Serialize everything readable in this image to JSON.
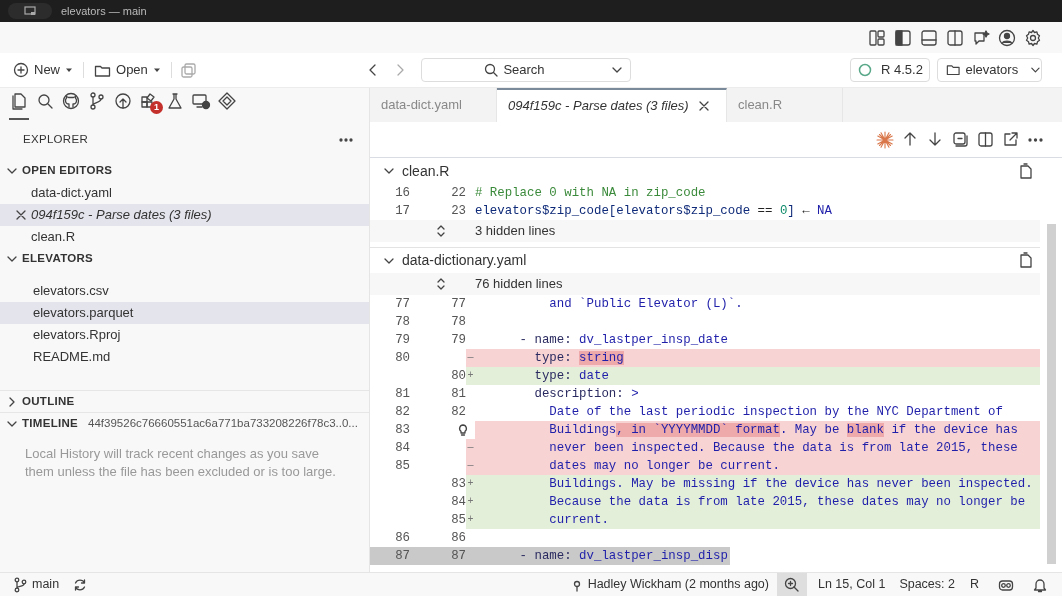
{
  "window": {
    "title": "elevators — main"
  },
  "toolbar": {
    "new_button": "New",
    "open_button": "Open",
    "search": "Search",
    "r_version": "R 4.5.2",
    "project": "elevators"
  },
  "activity_bar": [
    {
      "selected": true
    },
    {
      "selected": false
    },
    {
      "selected": false
    },
    {
      "selected": false
    },
    {
      "selected": false
    },
    {
      "selected": false,
      "badge": "1"
    },
    {
      "selected": false
    },
    {
      "selected": false
    },
    {
      "selected": false
    }
  ],
  "explorer": {
    "title": "EXPLORER",
    "sections": [
      {
        "title": "OPEN EDITORS",
        "expanded": true,
        "items": [
          {
            "label": "data-dict.yaml",
            "kind": "file",
            "selected": false
          },
          {
            "label": "094f159c - Parse dates (3 files)",
            "kind": "diff",
            "selected": true
          },
          {
            "label": "clean.R",
            "kind": "file",
            "selected": false
          }
        ]
      },
      {
        "title": "ELEVATORS",
        "expanded": true,
        "items": [
          {
            "label": "elevators.csv",
            "kind": "file",
            "selected": false
          },
          {
            "label": "elevators.parquet",
            "kind": "file",
            "selected": true
          },
          {
            "label": "elevators.Rproj",
            "kind": "file",
            "selected": false
          },
          {
            "label": "README.md",
            "kind": "file",
            "selected": false
          }
        ]
      },
      {
        "title": "OUTLINE",
        "expanded": false
      },
      {
        "title": "TIMELINE",
        "expanded": true,
        "detail": "44f39526c76660551ac6a771ba733208226f78c3..0...",
        "message": "Local History will track recent changes as you save them unless the file has been excluded or is too large."
      }
    ]
  },
  "tabs": [
    {
      "label": "data-dict.yaml",
      "kind": "file",
      "selected": false
    },
    {
      "label": "094f159c - Parse dates (3 files)",
      "kind": "diff",
      "selected": true
    },
    {
      "label": "clean.R",
      "kind": "file",
      "selected": false
    }
  ],
  "diff_files": [
    {
      "name": "clean.R",
      "expanded": true,
      "rows": [
        {
          "kind": "context",
          "old": "16",
          "new": "22",
          "segments": [
            {
              "text": "# Replace 0 with NA in zip_code",
              "kind": "comment",
              "changed": false
            }
          ]
        },
        {
          "kind": "context",
          "old": "17",
          "new": "23",
          "segments": [
            {
              "text": "elevators$zip_code[elevators$zip_code ",
              "kind": "ident",
              "changed": false
            },
            {
              "text": "== ",
              "kind": "op",
              "changed": false
            },
            {
              "text": "0",
              "kind": "number",
              "changed": false
            },
            {
              "text": "] ",
              "kind": "ident",
              "changed": false
            },
            {
              "text": "← ",
              "kind": "op",
              "changed": false
            },
            {
              "text": "NA",
              "kind": "value",
              "changed": false
            }
          ]
        },
        {
          "kind": "hidden",
          "text": "3 hidden lines"
        }
      ]
    },
    {
      "name": "data-dictionary.yaml",
      "expanded": true,
      "rows": [
        {
          "kind": "hidden",
          "text": "76 hidden lines"
        },
        {
          "kind": "context",
          "old": "77",
          "new": "77",
          "segments": [
            {
              "text": "          and `Public Elevator (L)`.",
              "kind": "value",
              "changed": false
            }
          ]
        },
        {
          "kind": "context",
          "old": "78",
          "new": "78"
        },
        {
          "kind": "context",
          "old": "79",
          "new": "79",
          "segments": [
            {
              "text": "      - name: ",
              "kind": "key",
              "changed": false
            },
            {
              "text": "dv_lastper_insp_date",
              "kind": "value",
              "changed": false
            }
          ]
        },
        {
          "kind": "removed",
          "old": "80",
          "marker": "—",
          "segments": [
            {
              "text": "        type: ",
              "kind": "key",
              "changed": false
            },
            {
              "text": "string",
              "kind": "value",
              "changed": true
            }
          ]
        },
        {
          "kind": "added",
          "new": "80",
          "marker": "+",
          "segments": [
            {
              "text": "        type: ",
              "kind": "key",
              "changed": false
            },
            {
              "text": "date",
              "kind": "value",
              "changed": false
            }
          ]
        },
        {
          "kind": "context",
          "old": "81",
          "new": "81",
          "segments": [
            {
              "text": "        description: ",
              "kind": "key",
              "changed": false
            },
            {
              "text": ">",
              "kind": "value",
              "changed": false
            }
          ]
        },
        {
          "kind": "context",
          "old": "82",
          "new": "82",
          "segments": [
            {
              "text": "          Date of the last periodic inspection by the NYC Department of",
              "kind": "value",
              "changed": false
            }
          ]
        },
        {
          "kind": "removed",
          "old": "83",
          "gutter_icon": {
            "kind": "lightbulb"
          },
          "segments": [
            {
              "text": "          Buildings",
              "kind": "value",
              "changed": false
            },
            {
              "text": ", in `YYYYMMDD` format",
              "kind": "value",
              "changed": true
            },
            {
              "text": ". May be ",
              "kind": "value",
              "changed": false
            },
            {
              "text": "blank",
              "kind": "value",
              "changed": true
            },
            {
              "text": " if the device has",
              "kind": "value",
              "changed": false
            }
          ]
        },
        {
          "kind": "removed",
          "old": "84",
          "marker": "—",
          "segments": [
            {
              "text": "          never been inspected. Because the data is from late 2015, these",
              "kind": "value",
              "changed": false
            }
          ]
        },
        {
          "kind": "removed",
          "old": "85",
          "marker": "—",
          "segments": [
            {
              "text": "          dates may no longer be current.",
              "kind": "value",
              "changed": false
            }
          ]
        },
        {
          "kind": "added",
          "new": "83",
          "marker": "+",
          "segments": [
            {
              "text": "          Buildings. May be missing if the device has never been inspected.",
              "kind": "value",
              "changed": false
            }
          ]
        },
        {
          "kind": "added",
          "new": "84",
          "marker": "+",
          "segments": [
            {
              "text": "          Because the data is from late 2015, these dates may no longer be",
              "kind": "value",
              "changed": false
            }
          ]
        },
        {
          "kind": "added",
          "new": "85",
          "marker": "+",
          "segments": [
            {
              "text": "          current.",
              "kind": "value",
              "changed": false
            }
          ]
        },
        {
          "kind": "context",
          "old": "86",
          "new": "86"
        },
        {
          "kind": "current",
          "old": "87",
          "new": "87",
          "segments": [
            {
              "text": "      - name: ",
              "kind": "key",
              "changed": false
            },
            {
              "text": "dv_lastper_insp_disp",
              "kind": "value",
              "changed": false
            }
          ]
        }
      ]
    }
  ],
  "status_bar": {
    "branch": "main",
    "blame": "Hadley Wickham (2 months ago)",
    "position": "Ln 15, Col 1",
    "indent": "Spaces: 2",
    "language": "R"
  }
}
